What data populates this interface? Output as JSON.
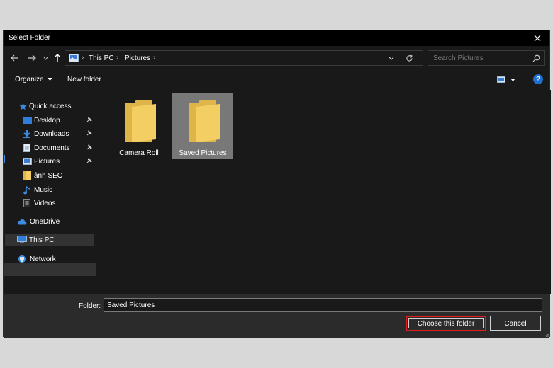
{
  "window": {
    "title": "Select Folder"
  },
  "address": {
    "crumbs": [
      "This PC",
      "Pictures"
    ]
  },
  "search": {
    "placeholder": "Search Pictures"
  },
  "toolbar": {
    "organize_label": "Organize",
    "new_folder_label": "New folder"
  },
  "nav": {
    "quick_access": "Quick access",
    "items": [
      {
        "label": "Desktop",
        "icon": "desktop-icon",
        "pinned": true
      },
      {
        "label": "Downloads",
        "icon": "download-arrow-icon",
        "pinned": true
      },
      {
        "label": "Documents",
        "icon": "document-icon",
        "pinned": true
      },
      {
        "label": "Pictures",
        "icon": "pictures-icon",
        "pinned": true
      },
      {
        "label": "ảnh SEO",
        "icon": "folder-icon",
        "pinned": false
      },
      {
        "label": "Music",
        "icon": "music-note-icon",
        "pinned": false
      },
      {
        "label": "Videos",
        "icon": "video-icon",
        "pinned": false
      }
    ],
    "onedrive": "OneDrive",
    "this_pc": "This PC",
    "network": "Network"
  },
  "content": {
    "folders": [
      {
        "name": "Camera Roll",
        "selected": false
      },
      {
        "name": "Saved Pictures",
        "selected": true
      }
    ]
  },
  "footer": {
    "folder_label": "Folder:",
    "folder_value": "Saved Pictures",
    "choose_label": "Choose this folder",
    "cancel_label": "Cancel"
  },
  "colors": {
    "background": "#191919",
    "titlebar": "#000000",
    "footer": "#2b2b2b",
    "selection": "#787878",
    "highlight_border": "#e01e1e",
    "folder_yellow": "#f3cf63"
  }
}
